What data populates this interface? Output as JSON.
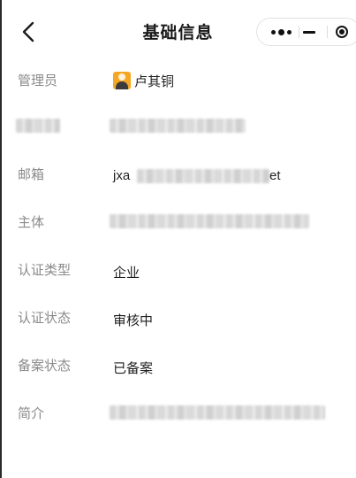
{
  "navbar": {
    "title": "基础信息",
    "back_icon": "chevron-left-icon",
    "capsule_icons": [
      "more-dots-icon",
      "minimize-icon",
      "close-target-icon"
    ]
  },
  "fields": {
    "admin": {
      "label": "管理员",
      "value": "卢其铜",
      "avatar_icon": "avatar-icon"
    },
    "email": {
      "label": "邮箱",
      "value_visible_prefix": "jxa",
      "value_visible_suffix": "et"
    },
    "entity": {
      "label": "主体"
    },
    "cert_type": {
      "label": "认证类型",
      "value": "企业"
    },
    "cert_status": {
      "label": "认证状态",
      "value": "审核中"
    },
    "filing_status": {
      "label": "备案状态",
      "value": "已备案"
    },
    "intro": {
      "label": "简介"
    }
  }
}
